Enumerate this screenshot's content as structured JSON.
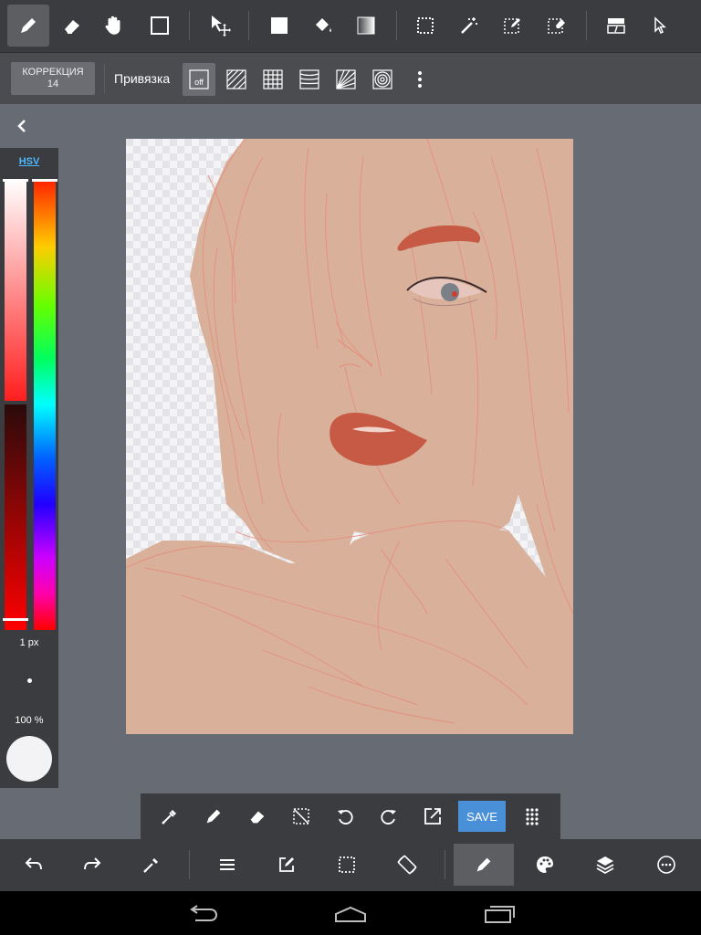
{
  "toolbar": {
    "tools": [
      {
        "icon": "pen-icon",
        "active": true
      },
      {
        "icon": "eraser-icon"
      },
      {
        "icon": "hand-icon"
      },
      {
        "icon": "square-outline-icon"
      },
      {
        "icon": "move-icon"
      },
      {
        "icon": "fill-square-icon"
      },
      {
        "icon": "bucket-icon"
      },
      {
        "icon": "gradient-icon"
      },
      {
        "icon": "rect-select-icon"
      },
      {
        "icon": "magic-wand-icon"
      },
      {
        "icon": "select-pen-icon"
      },
      {
        "icon": "select-eraser-icon"
      },
      {
        "icon": "layer-panel-icon"
      },
      {
        "icon": "cursor-icon"
      }
    ]
  },
  "subbar": {
    "correction_label": "КОРРЕКЦИЯ",
    "correction_value": "14",
    "snap_label": "Привязка",
    "snap_off_label": "off",
    "snap_modes": [
      "snap-off-icon",
      "snap-parallel-icon",
      "snap-grid-icon",
      "snap-curve-icon",
      "snap-radial-icon",
      "snap-circle-icon",
      "more-vertical-icon"
    ]
  },
  "color_panel": {
    "tab": "HSV",
    "brush_size": "1 px",
    "opacity": "100 %",
    "current_color": "#f3f3f6",
    "saturation_level": 1.0,
    "value_level": 0.0
  },
  "quickbar": {
    "tools": [
      "eyedropper-icon",
      "pen-icon",
      "eraser-icon",
      "deselect-icon",
      "rotate-left-icon",
      "rotate-right-icon",
      "export-icon"
    ],
    "save_label": "SAVE",
    "grid_icon": "dots-grid-icon"
  },
  "bottombar": {
    "tools": [
      "undo-icon",
      "redo-icon",
      "eyedropper-icon",
      "menu-icon",
      "edit-icon",
      "selection-icon",
      "rotate-screen-icon",
      "brush-icon",
      "palette-icon",
      "layers-icon",
      "settings-icon"
    ]
  },
  "navbar": {
    "buttons": [
      "back-icon",
      "home-icon",
      "recent-apps-icon"
    ]
  },
  "colors": {
    "skin": "#d9b09a",
    "lips": "#c65a45",
    "sketch_lines": "#e58a78",
    "accent": "#4a90d9"
  }
}
